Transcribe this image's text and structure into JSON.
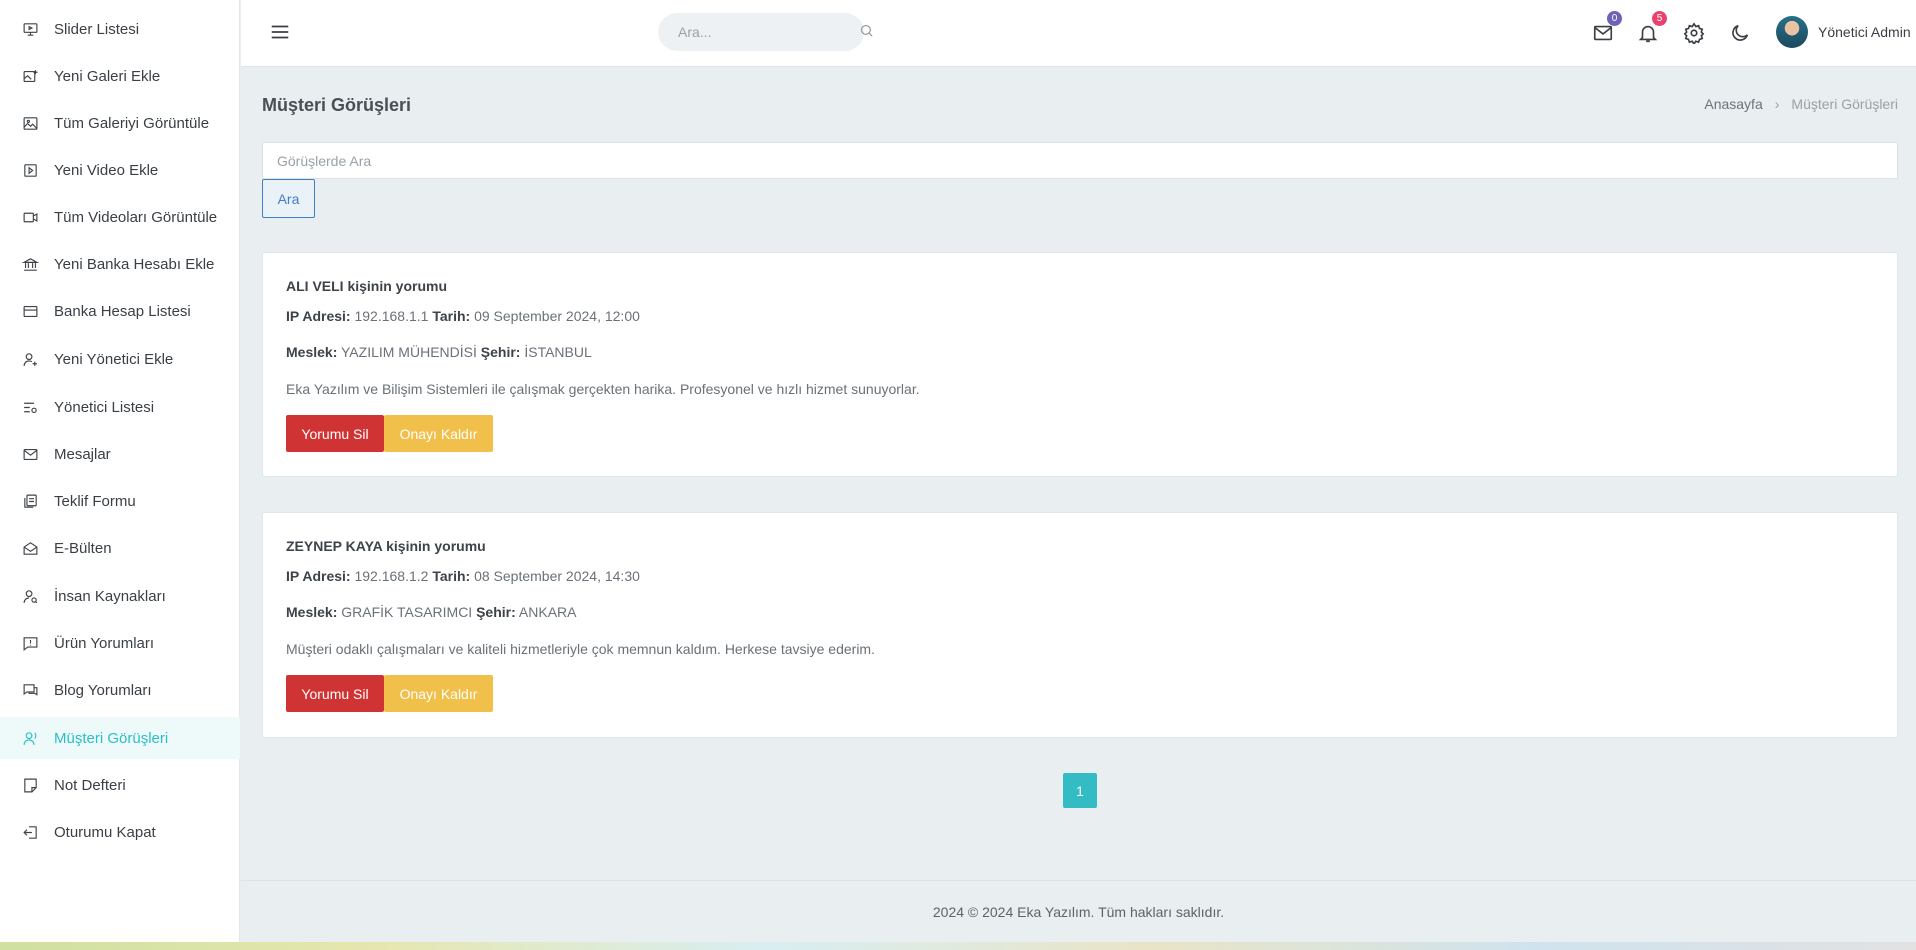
{
  "sidebar": {
    "items": [
      {
        "label": "Slider Listesi",
        "icon": "monitor-icon"
      },
      {
        "label": "Yeni Galeri Ekle",
        "icon": "gallery-add-icon"
      },
      {
        "label": "Tüm Galeriyi Görüntüle",
        "icon": "image-icon"
      },
      {
        "label": "Yeni Video Ekle",
        "icon": "video-square-icon"
      },
      {
        "label": "Tüm Videoları Görüntüle",
        "icon": "video-camera-icon"
      },
      {
        "label": "Yeni Banka Hesabı Ekle",
        "icon": "bank-icon"
      },
      {
        "label": "Banka Hesap Listesi",
        "icon": "credit-card-icon"
      },
      {
        "label": "Yeni Yönetici Ekle",
        "icon": "user-add-icon"
      },
      {
        "label": "Yönetici Listesi",
        "icon": "list-settings-icon"
      },
      {
        "label": "Mesajlar",
        "icon": "mail-icon"
      },
      {
        "label": "Teklif Formu",
        "icon": "documents-icon"
      },
      {
        "label": "E-Bülten",
        "icon": "mail-open-icon"
      },
      {
        "label": "İnsan Kaynakları",
        "icon": "user-search-icon"
      },
      {
        "label": "Ürün Yorumları",
        "icon": "comment-alert-icon"
      },
      {
        "label": "Blog Yorumları",
        "icon": "comments-icon"
      },
      {
        "label": "Müşteri Görüşleri",
        "icon": "user-voice-icon",
        "active": true
      },
      {
        "label": "Not Defteri",
        "icon": "note-icon"
      },
      {
        "label": "Oturumu Kapat",
        "icon": "logout-icon"
      }
    ]
  },
  "topbar": {
    "search_placeholder": "Ara...",
    "mail_count": "0",
    "notification_count": "5",
    "username": "Yönetici Admin",
    "mail_badge_color": "#6c63b8",
    "notification_badge_color": "#e8436e"
  },
  "page": {
    "title": "Müşteri Görüşleri",
    "breadcrumb": {
      "home": "Anasayfa",
      "current": "Müşteri Görüşleri"
    },
    "search_placeholder": "Görüşlerde Ara",
    "search_button": "Ara"
  },
  "reviews": [
    {
      "title": "ALI VELI kişinin yorumu",
      "ip_label": "IP Adresi:",
      "ip": "192.168.1.1",
      "date_label": "Tarih:",
      "date": "09 September 2024, 12:00",
      "job_label": "Meslek:",
      "job": "YAZILIM MÜHENDİSİ",
      "city_label": "Şehir:",
      "city": "İSTANBUL",
      "comment": "Eka Yazılım ve Bilişim Sistemleri ile çalışmak gerçekten harika. Profesyonel ve hızlı hizmet sunuyorlar.",
      "delete_label": "Yorumu Sil",
      "unapprove_label": "Onayı Kaldır"
    },
    {
      "title": "ZEYNEP KAYA kişinin yorumu",
      "ip_label": "IP Adresi:",
      "ip": "192.168.1.2",
      "date_label": "Tarih:",
      "date": "08 September 2024, 14:30",
      "job_label": "Meslek:",
      "job": "GRAFİK TASARIMCI",
      "city_label": "Şehir:",
      "city": "ANKARA",
      "comment": "Müşteri odaklı çalışmaları ve kaliteli hizmetleriyle çok memnun kaldım. Herkese tavsiye ederim.",
      "delete_label": "Yorumu Sil",
      "unapprove_label": "Onayı Kaldır"
    }
  ],
  "pagination": {
    "current": "1"
  },
  "footer": {
    "text": "2024 © 2024 Eka Yazılım. Tüm hakları saklıdır."
  },
  "colors": {
    "accent": "#2bbfc7",
    "danger": "#d03333",
    "warning": "#f1c04b",
    "primary": "#3b82c4"
  }
}
